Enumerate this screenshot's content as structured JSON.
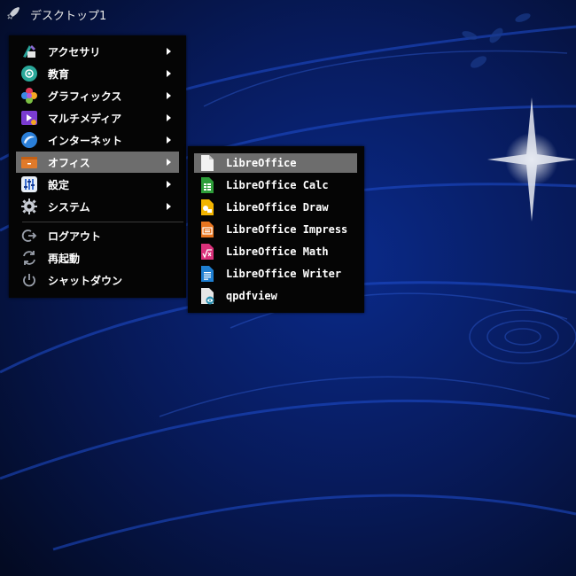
{
  "topbar": {
    "title": "デスクトップ1",
    "icon": "rocket-icon"
  },
  "menu": {
    "categories": [
      {
        "label": "アクセサリ",
        "icon": "accessories-icon"
      },
      {
        "label": "教育",
        "icon": "education-icon"
      },
      {
        "label": "グラフィックス",
        "icon": "graphics-icon"
      },
      {
        "label": "マルチメディア",
        "icon": "multimedia-icon"
      },
      {
        "label": "インターネット",
        "icon": "internet-icon"
      },
      {
        "label": "オフィス",
        "icon": "office-icon",
        "active": true
      },
      {
        "label": "設定",
        "icon": "settings-icon"
      },
      {
        "label": "システム",
        "icon": "system-icon"
      }
    ],
    "actions": [
      {
        "label": "ログアウト",
        "icon": "logout-icon"
      },
      {
        "label": "再起動",
        "icon": "restart-icon"
      },
      {
        "label": "シャットダウン",
        "icon": "power-icon"
      }
    ]
  },
  "submenu": {
    "items": [
      {
        "label": "LibreOffice",
        "icon": "libreoffice-icon",
        "active": true
      },
      {
        "label": "LibreOffice Calc",
        "icon": "calc-icon"
      },
      {
        "label": "LibreOffice Draw",
        "icon": "draw-icon"
      },
      {
        "label": "LibreOffice Impress",
        "icon": "impress-icon"
      },
      {
        "label": "LibreOffice Math",
        "icon": "math-icon"
      },
      {
        "label": "LibreOffice Writer",
        "icon": "writer-icon"
      },
      {
        "label": "qpdfview",
        "icon": "pdf-viewer-icon"
      }
    ]
  },
  "colors": {
    "menu_bg": "#050505",
    "highlight": "#6d6d6d",
    "calc": "#2e9e3a",
    "draw": "#f2b400",
    "impress": "#e8751f",
    "math": "#d9317a",
    "writer": "#1f7fd1"
  }
}
